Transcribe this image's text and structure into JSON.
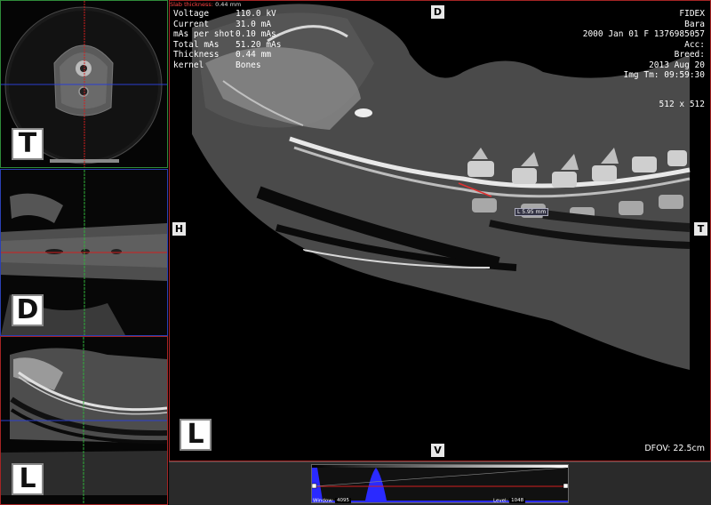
{
  "viewports": {
    "axial": {
      "orientation_letter": "T",
      "border_color": "#2f8c3a"
    },
    "dorsal": {
      "orientation_letter": "D",
      "border_color": "#2a3fb5"
    },
    "lateral": {
      "orientation_letter": "L",
      "border_color": "#a52424"
    }
  },
  "main_view": {
    "slab": {
      "label": "Slab thickness:",
      "value": "0.44 mm"
    },
    "acquisition": [
      {
        "key": "Voltage",
        "value": "110.0 kV"
      },
      {
        "key": "Current",
        "value": "31.0 mA"
      },
      {
        "key": "mAs per shot",
        "value": "0.10 mAs"
      },
      {
        "key": "Total mAs",
        "value": "51.20 mAs"
      },
      {
        "key": "Thickness",
        "value": "0.44 mm"
      },
      {
        "key": "kernel",
        "value": "Bones"
      }
    ],
    "patient": {
      "institution": "FIDEX",
      "name": "Bara",
      "dob_sex_id": "2000 Jan 01   F   1376985057",
      "acc": "Acc:",
      "breed": "Breed:",
      "date": "2013 Aug 20",
      "img_time": "Img Tm: 09:59:30"
    },
    "matrix": "512 x 512",
    "dfov": "DFOV: 22.5cm",
    "orientation": {
      "top": "D",
      "bottom": "V",
      "left": "H",
      "right": "T"
    },
    "orientation_badge": "L",
    "measurement": "L 5.95 mm"
  },
  "histogram": {
    "window_label": "Window:",
    "window_value": "4095",
    "level_label": "Level:",
    "level_value": "1048",
    "fill_color": "#2a2aff"
  }
}
